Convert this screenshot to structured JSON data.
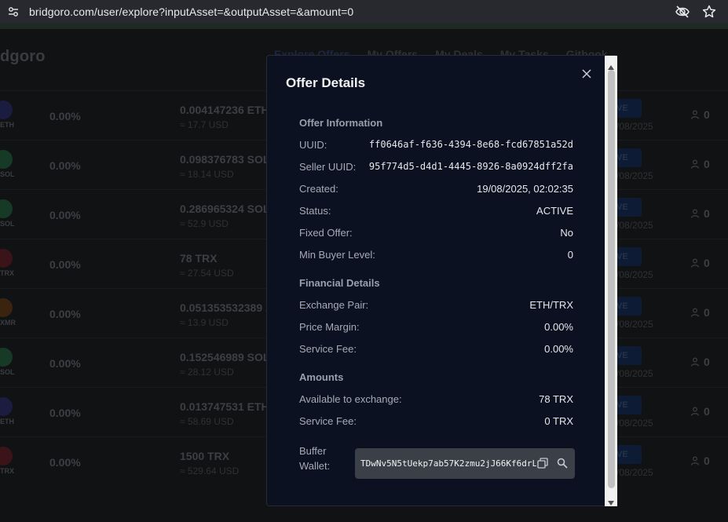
{
  "browser": {
    "url": "bridgoro.com/user/explore?inputAsset=&outputAsset=&amount=0"
  },
  "background": {
    "brand": "dgoro",
    "nav": [
      "Explore Offers",
      "My Offers",
      "My Deals",
      "My Tasks",
      "Gitbook"
    ],
    "rows": [
      {
        "sym": "ETH",
        "pct": "0.00%",
        "amount": "0.004147236 ETH",
        "usd": "≈ 17.7 USD",
        "badge": "IVE",
        "date": "/08/2025",
        "users": "0",
        "color": "#1a1c40"
      },
      {
        "sym": "SOL",
        "pct": "0.00%",
        "amount": "0.098376783 SOL",
        "usd": "≈ 18.14 USD",
        "badge": "IVE",
        "date": "/08/2025",
        "users": "0",
        "color": "#173a26"
      },
      {
        "sym": "SOL",
        "pct": "0.00%",
        "amount": "0.286965324 SOL",
        "usd": "≈ 52.9 USD",
        "badge": "IVE",
        "date": "/08/2025",
        "users": "0",
        "color": "#173a26"
      },
      {
        "sym": "TRX",
        "pct": "0.00%",
        "amount": "78 TRX",
        "usd": "≈ 27.54 USD",
        "badge": "IVE",
        "date": "/08/2025",
        "users": "0",
        "color": "#3a1418"
      },
      {
        "sym": "XMR",
        "pct": "0.00%",
        "amount": "0.051353532389 X",
        "usd": "≈ 13.9 USD",
        "badge": "IVE",
        "date": "/08/2025",
        "users": "0",
        "color": "#3a2410"
      },
      {
        "sym": "SOL",
        "pct": "0.00%",
        "amount": "0.152546989 SOL",
        "usd": "≈ 28.12 USD",
        "badge": "IVE",
        "date": "/08/2025",
        "users": "0",
        "color": "#173a26"
      },
      {
        "sym": "ETH",
        "pct": "0.00%",
        "amount": "0.013747531 ETH",
        "usd": "≈ 58.69 USD",
        "badge": "IVE",
        "date": "/08/2025",
        "users": "0",
        "color": "#1a1c40"
      },
      {
        "sym": "TRX",
        "pct": "0.00%",
        "amount": "1500 TRX",
        "usd": "≈ 529.64 USD",
        "badge": "IVE",
        "date": "/08/2025",
        "users": "0",
        "color": "#3a1418"
      }
    ]
  },
  "modal": {
    "title": "Offer Details",
    "offer_info": {
      "heading": "Offer Information",
      "uuid_label": "UUID:",
      "uuid": "ff0646af-f636-4394-8e68-fcd67851a52d",
      "seller_label": "Seller UUID:",
      "seller_uuid": "95f774d5-d4d1-4445-8926-8a0924dff2fa",
      "created_label": "Created:",
      "created": "19/08/2025, 02:02:35",
      "status_label": "Status:",
      "status": "ACTIVE",
      "fixed_label": "Fixed Offer:",
      "fixed": "No",
      "min_level_label": "Min Buyer Level:",
      "min_level": "0"
    },
    "financial": {
      "heading": "Financial Details",
      "pair_label": "Exchange Pair:",
      "pair": "ETH/TRX",
      "margin_label": "Price Margin:",
      "margin": "0.00%",
      "fee_label": "Service Fee:",
      "fee": "0.00%"
    },
    "amounts": {
      "heading": "Amounts",
      "available_label": "Available to exchange:",
      "available": "78 TRX",
      "fee_label": "Service Fee:",
      "fee": "0 TRX"
    },
    "wallet": {
      "label_line1": "Buffer",
      "label_line2": "Wallet:",
      "address": "TDwNv5N5tUekp7ab57K2zmu2jJ66Kf6drL"
    }
  }
}
